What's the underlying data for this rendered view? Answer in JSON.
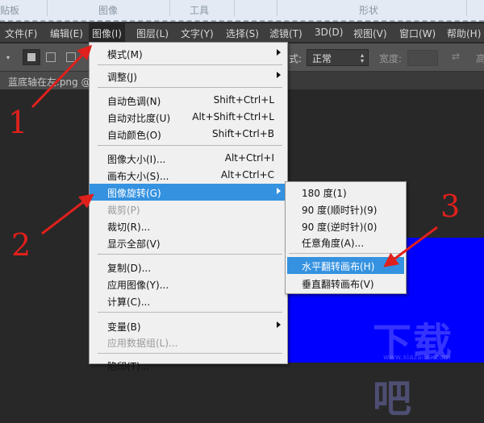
{
  "ribbon": {
    "groups": [
      "贴板",
      "图像",
      "工具",
      "形状"
    ]
  },
  "menubar": [
    "文件(F)",
    "编辑(E)",
    "图像(I)",
    "图层(L)",
    "文字(Y)",
    "选择(S)",
    "滤镜(T)",
    "3D(D)",
    "视图(V)",
    "窗口(W)",
    "帮助(H)"
  ],
  "options": {
    "style_label": "式:",
    "style_value": "正常",
    "width_label": "宽度:",
    "height_label": "高"
  },
  "tab": {
    "title": "蓝底轴在左.png @"
  },
  "image_menu": [
    {
      "label": "模式(M)",
      "submenu": true
    },
    {
      "label": "调整(J)",
      "submenu": true
    },
    {
      "label": "自动色调(N)",
      "shortcut": "Shift+Ctrl+L"
    },
    {
      "label": "自动对比度(U)",
      "shortcut": "Alt+Shift+Ctrl+L"
    },
    {
      "label": "自动颜色(O)",
      "shortcut": "Shift+Ctrl+B"
    },
    {
      "label": "图像大小(I)...",
      "shortcut": "Alt+Ctrl+I"
    },
    {
      "label": "画布大小(S)...",
      "shortcut": "Alt+Ctrl+C"
    },
    {
      "label": "图像旋转(G)",
      "submenu": true,
      "highlighted": true
    },
    {
      "label": "裁剪(P)",
      "disabled": true
    },
    {
      "label": "裁切(R)..."
    },
    {
      "label": "显示全部(V)"
    },
    {
      "label": "复制(D)..."
    },
    {
      "label": "应用图像(Y)..."
    },
    {
      "label": "计算(C)..."
    },
    {
      "label": "变量(B)",
      "submenu": true
    },
    {
      "label": "应用数据组(L)...",
      "disabled": true
    },
    {
      "label": "陷印(T)..."
    }
  ],
  "rotate_submenu": [
    "180 度(1)",
    "90 度(顺时针)(9)",
    "90 度(逆时针)(0)",
    "任意角度(A)...",
    "水平翻转画布(H)",
    "垂直翻转画布(V)"
  ],
  "annotations": {
    "step1": "1",
    "step2": "2",
    "step3": "3"
  },
  "watermark": {
    "text": "下载吧",
    "url": "www.xiazaiba.com"
  },
  "colors": {
    "highlight": "#3592e0",
    "canvas": "#0000fe",
    "annotation": "#e0201c"
  }
}
